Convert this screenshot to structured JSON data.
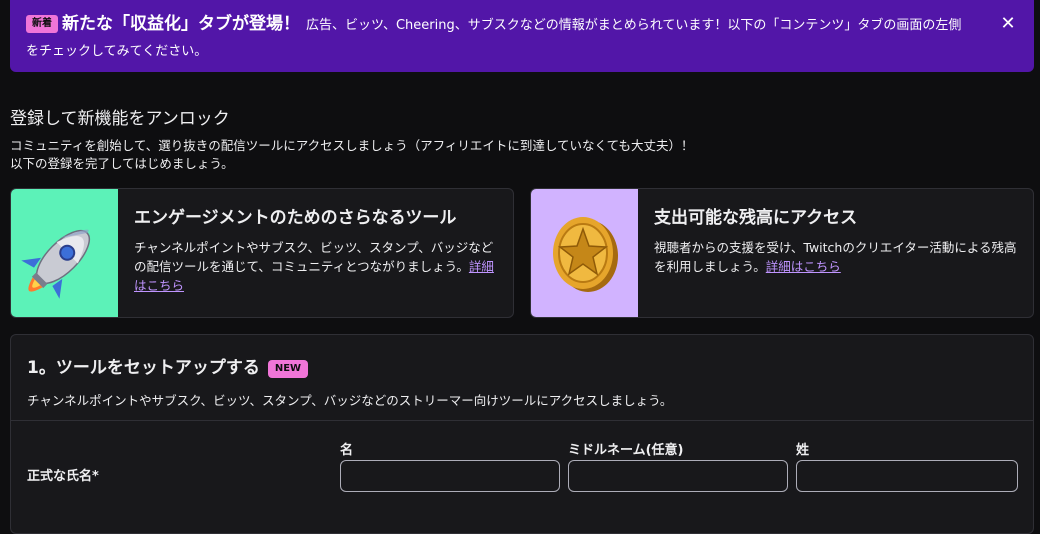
{
  "banner": {
    "badge": "新着",
    "title": "新たな「収益化」タブが登場！",
    "text": "広告、ビッツ、Cheering、サブスクなどの情報がまとめられています！以下の「コンテンツ」タブの画面の左側をチェックしてみてください。",
    "close_icon": "close-icon"
  },
  "unlock": {
    "heading": "登録して新機能をアンロック",
    "line1": "コミュニティを創始して、選り抜きの配信ツールにアクセスしましょう（アフィリエイトに到達していなくても大丈夫）！",
    "line2": "以下の登録を完了してはじめましょう。"
  },
  "cards": [
    {
      "icon": "rocket-icon",
      "title": "エンゲージメントのためのさらなるツール",
      "desc": "チャンネルポイントやサブスク、ビッツ、スタンプ、バッジなどの配信ツールを通じて、コミュニティとつながりましょう。",
      "link": "詳細はこちら"
    },
    {
      "icon": "coin-icon",
      "title": "支出可能な残高にアクセス",
      "desc": "視聴者からの支援を受け、Twitchのクリエイター活動による残高を利用しましょう。",
      "link": "詳細はこちら"
    }
  ],
  "setup": {
    "title": "1。ツールをセットアップする",
    "badge": "NEW",
    "desc": "チャンネルポイントやサブスク、ビッツ、スタンプ、バッジなどのストリーマー向けツールにアクセスしましょう。",
    "name_label": "正式な氏名*",
    "first_label": "名",
    "middle_label": "ミドルネーム(任意)",
    "last_label": "姓",
    "first_value": "",
    "middle_value": "",
    "last_value": ""
  },
  "colors": {
    "banner": "#5216a8",
    "accent_link": "#bf94ff",
    "badge": "#f075d8",
    "card1_art": "#5cf2b8",
    "card2_art": "#d1b3ff"
  }
}
